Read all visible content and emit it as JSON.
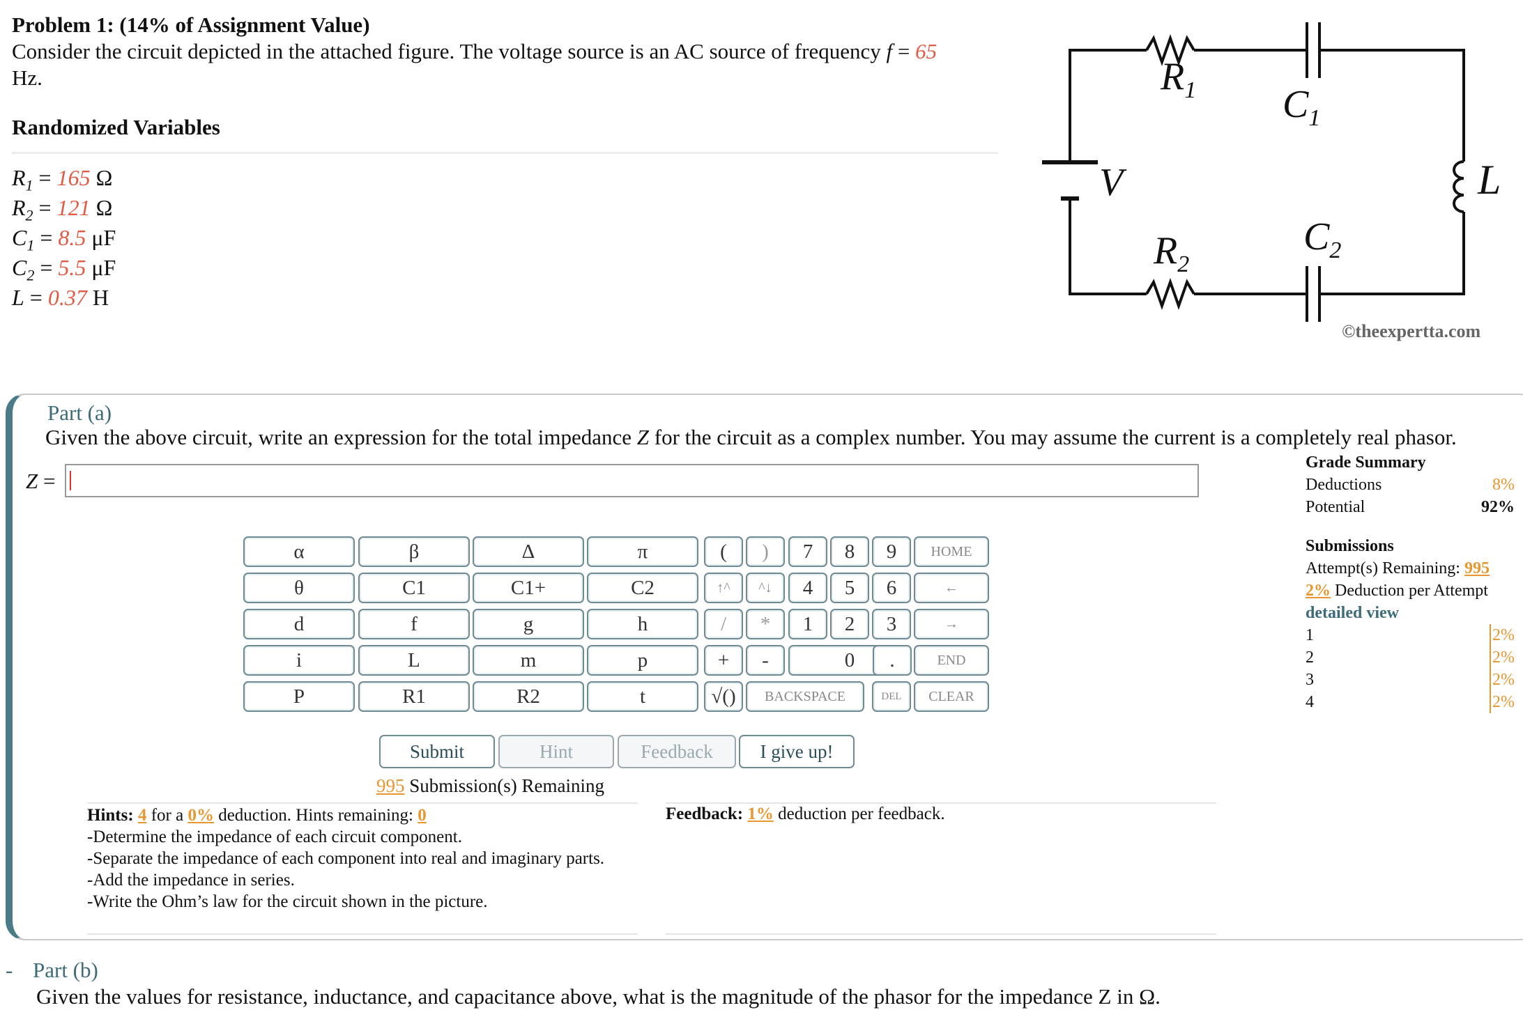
{
  "problem": {
    "title": "Problem 1: (14% of Assignment Value)",
    "text_pre": "Consider the circuit depicted in the attached figure. The voltage source is an AC source of frequency",
    "f_symbol": "f",
    "equals": "=",
    "f_value": "65",
    "f_unit": "Hz."
  },
  "randomized": {
    "title": "Randomized Variables",
    "vars": [
      {
        "sym": "R",
        "sub": "1",
        "value": "165",
        "unit": "Ω"
      },
      {
        "sym": "R",
        "sub": "2",
        "value": "121",
        "unit": "Ω"
      },
      {
        "sym": "C",
        "sub": "1",
        "value": "8.5",
        "unit": "μF"
      },
      {
        "sym": "C",
        "sub": "2",
        "value": "5.5",
        "unit": "μF"
      },
      {
        "sym": "L",
        "sub": "",
        "value": "0.37",
        "unit": "H"
      }
    ]
  },
  "circuit": {
    "labels": {
      "R1": "R",
      "R1_sub": "1",
      "C1": "C",
      "C1_sub": "1",
      "L": "L",
      "V": "V",
      "R2": "R",
      "R2_sub": "2",
      "C2": "C",
      "C2_sub": "2"
    },
    "copyright": "©theexpertta.com"
  },
  "part_a": {
    "title": "Part (a)",
    "question_pre": "Given the above circuit, write an expression for the total impedance",
    "question_sym": "Z",
    "question_post": "for the circuit as a complex number. You may assume the current is a completely real phasor.",
    "input_label_sym": "Z",
    "input_label_eq": "=",
    "input_value": ""
  },
  "keypad": {
    "symbols": [
      [
        "α",
        "β",
        "Δ",
        "π"
      ],
      [
        "θ",
        "C1",
        "C1+",
        "C2"
      ],
      [
        "d",
        "f",
        "g",
        "h"
      ],
      [
        "i",
        "L",
        "m",
        "p"
      ],
      [
        "P",
        "R1",
        "R2",
        "t"
      ]
    ],
    "paren_open": "(",
    "paren_close": ")",
    "up": "↑^",
    "down": "^↓",
    "slash": "/",
    "star": "*",
    "plus": "+",
    "minus": "-",
    "sqrt": "√()",
    "digits": [
      "7",
      "8",
      "9",
      "4",
      "5",
      "6",
      "1",
      "2",
      "3",
      "0",
      "."
    ],
    "home": "HOME",
    "left": "←",
    "right": "→",
    "end": "END",
    "backspace": "BACKSPACE",
    "del": "DEL",
    "clear": "CLEAR"
  },
  "actions": {
    "submit": "Submit",
    "hint": "Hint",
    "feedback": "Feedback",
    "give_up": "I give up!"
  },
  "submissions_line": {
    "count": "995",
    "text": "Submission(s) Remaining"
  },
  "hints": {
    "label": "Hints:",
    "count": "4",
    "for_a": "for a",
    "pct": "0%",
    "deduction_text": "deduction. Hints remaining:",
    "remaining": "0",
    "items": [
      "-Determine the impedance of each circuit component.",
      "-Separate the impedance of each component into real and imaginary parts.",
      "-Add the impedance in series.",
      "-Write the Ohm’s law for the circuit shown in the picture."
    ]
  },
  "feedback": {
    "label": "Feedback:",
    "pct": "1%",
    "text": "deduction per feedback."
  },
  "grade_summary": {
    "title": "Grade Summary",
    "deductions_label": "Deductions",
    "deductions_value": "8%",
    "potential_label": "Potential",
    "potential_value": "92%",
    "submissions_title": "Submissions",
    "attempts_label": "Attempt(s) Remaining:",
    "attempts_value": "995",
    "deduction_pct": "2%",
    "deduction_text": "Deduction per Attempt",
    "detailed_view": "detailed view",
    "rows": [
      {
        "n": "1",
        "pct": "2%"
      },
      {
        "n": "2",
        "pct": "2%"
      },
      {
        "n": "3",
        "pct": "2%"
      },
      {
        "n": "4",
        "pct": "2%"
      }
    ]
  },
  "part_b": {
    "dash": "-",
    "title": "Part (b)",
    "question": "Given the values for resistance, inductance, and capacitance above, what is the magnitude of the phasor for the impedance Z in Ω."
  },
  "colors": {
    "accent": "#4b7b87",
    "highlight": "#e8962e",
    "variable": "#e05a44"
  }
}
